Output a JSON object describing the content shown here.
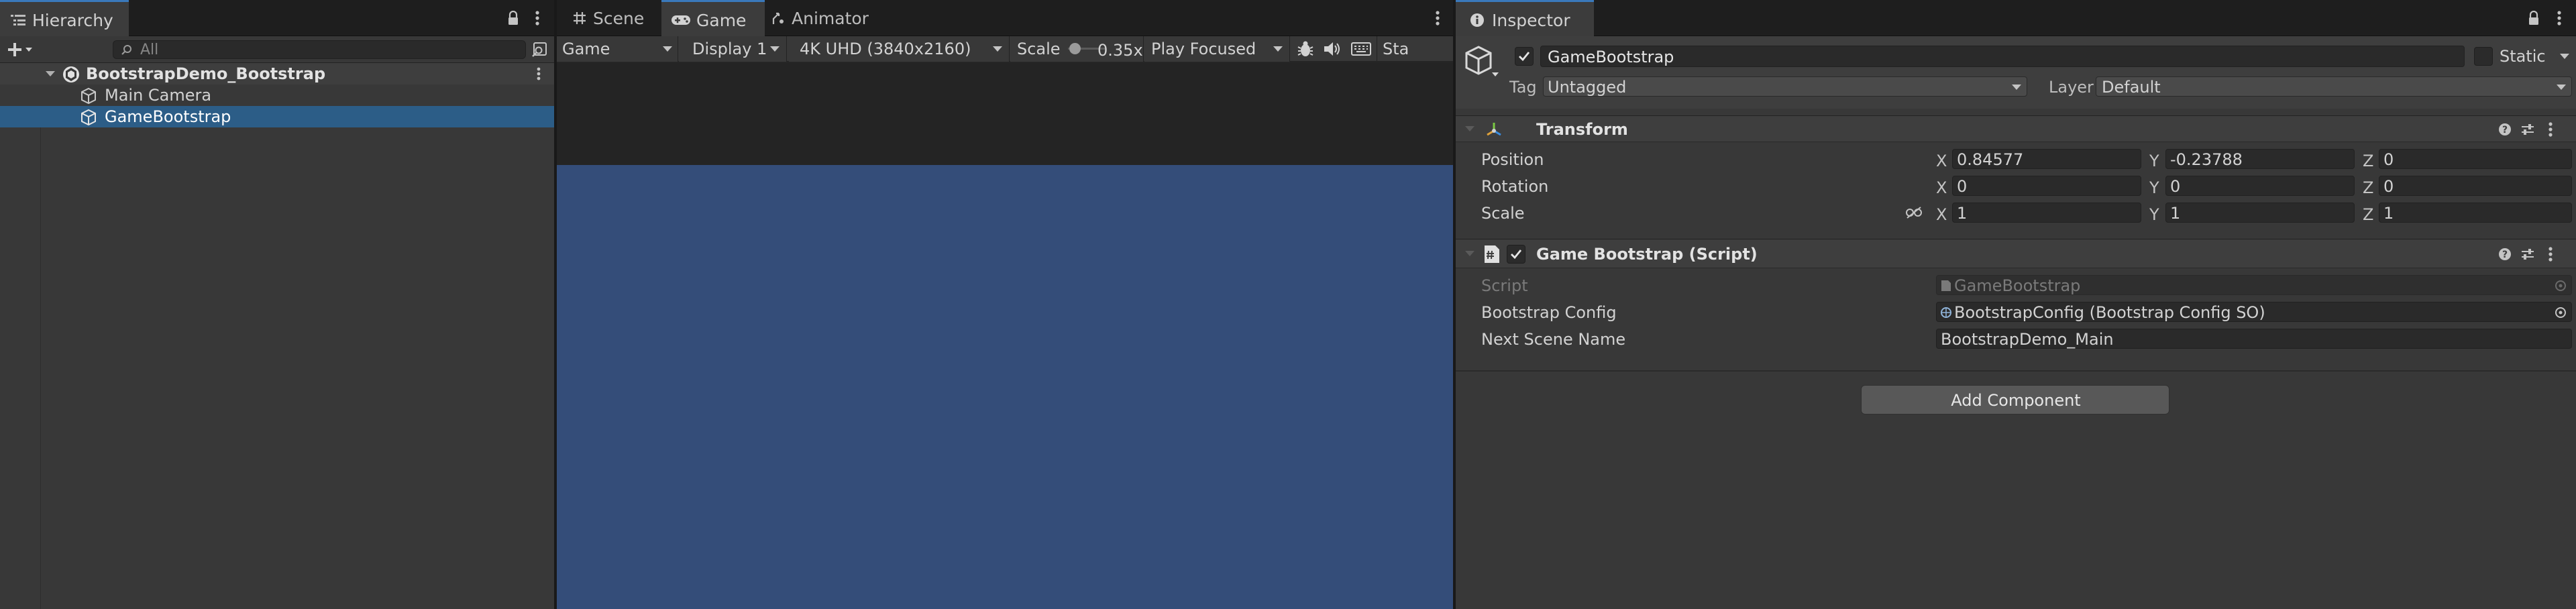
{
  "hierarchy": {
    "tab_label": "Hierarchy",
    "search_placeholder": "All",
    "scene_name": "BootstrapDemo_Bootstrap",
    "items": [
      {
        "label": "Main Camera"
      },
      {
        "label": "GameBootstrap"
      }
    ]
  },
  "center": {
    "tabs": [
      {
        "label": "Scene"
      },
      {
        "label": "Game"
      },
      {
        "label": "Animator"
      }
    ],
    "toolbar": {
      "view_select": "Game",
      "display_select": "Display 1",
      "resolution_select": "4K UHD (3840x2160)",
      "scale_label": "Scale",
      "scale_value": "0.35x",
      "play_mode_select": "Play Focused",
      "stats_truncated": "Sta"
    },
    "viewport_color": "#344d79"
  },
  "inspector": {
    "tab_label": "Inspector",
    "object_name": "GameBootstrap",
    "static_label": "Static",
    "tag_label": "Tag",
    "tag_value": "Untagged",
    "layer_label": "Layer",
    "layer_value": "Default",
    "transform": {
      "title": "Transform",
      "rows": [
        {
          "label": "Position",
          "x": "0.84577",
          "y": "-0.23788",
          "z": "0"
        },
        {
          "label": "Rotation",
          "x": "0",
          "y": "0",
          "z": "0"
        },
        {
          "label": "Scale",
          "x": "1",
          "y": "1",
          "z": "1"
        }
      ],
      "axis_x": "X",
      "axis_y": "Y",
      "axis_z": "Z"
    },
    "script_component": {
      "title": "Game Bootstrap (Script)",
      "script_label": "Script",
      "script_value": "GameBootstrap",
      "config_label": "Bootstrap Config",
      "config_value": "BootstrapConfig (Bootstrap Config SO)",
      "next_scene_label": "Next Scene Name",
      "next_scene_value": "BootstrapDemo_Main"
    },
    "add_component_label": "Add Component"
  },
  "colors": {
    "accent": "#3a79bb",
    "selection": "#2c5d87",
    "viewport": "#344d79"
  }
}
